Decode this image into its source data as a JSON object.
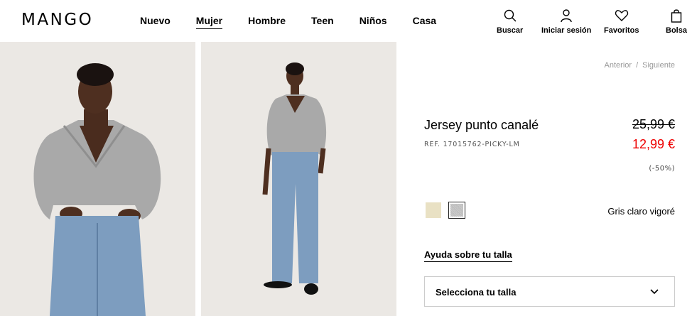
{
  "header": {
    "logo": "MANGO",
    "nav": [
      "Nuevo",
      "Mujer",
      "Hombre",
      "Teen",
      "Niños",
      "Casa"
    ],
    "active_nav": "Mujer",
    "utils": {
      "search": "Buscar",
      "login": "Iniciar sesión",
      "favorites": "Favoritos",
      "bag": "Bolsa"
    }
  },
  "product": {
    "pager": {
      "prev": "Anterior",
      "separator": "/",
      "next": "Siguiente"
    },
    "title": "Jersey punto canalé",
    "ref": "REF. 17015762-PICKY-LM",
    "price_old": "25,99 €",
    "price_new": "12,99 €",
    "discount": "(-50%)",
    "color_selected": "Gris claro vigoré",
    "size_help": "Ayuda sobre tu talla",
    "size_select": "Selecciona tu talla"
  },
  "colors": {
    "sale": "#e00000",
    "swatch_beige": "#e9e1c4",
    "swatch_grey": "#c4c4c4"
  },
  "icons": [
    "search-icon",
    "user-icon",
    "heart-icon",
    "bag-icon",
    "chevron-down-icon"
  ]
}
